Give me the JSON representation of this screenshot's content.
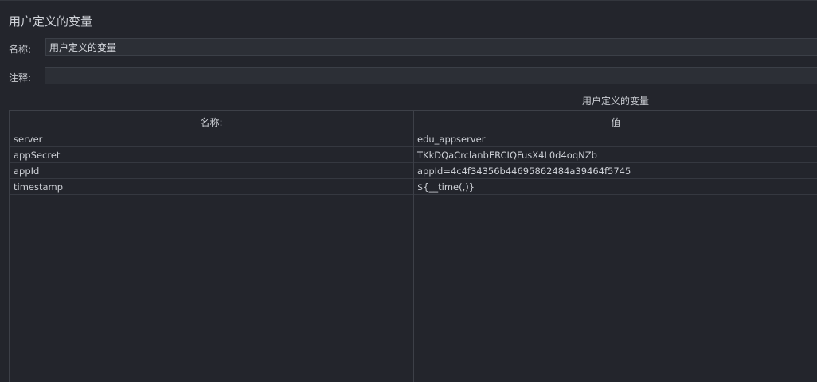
{
  "panel": {
    "title": "用户定义的变量"
  },
  "form": {
    "name_label": "名称:",
    "name_value": "用户定义的变量",
    "comment_label": "注释:",
    "comment_value": ""
  },
  "table": {
    "caption": "用户定义的变量",
    "headers": {
      "name": "名称:",
      "value": "值"
    },
    "rows": [
      {
        "name": "server",
        "value": "edu_appserver"
      },
      {
        "name": "appSecret",
        "value": "TKkDQaCrclanbERCIQFusX4L0d4oqNZb"
      },
      {
        "name": "appId",
        "value": "appId=4c4f34356b44695862484a39464f5745"
      },
      {
        "name": "timestamp",
        "value": "${__time(,)}"
      }
    ]
  }
}
